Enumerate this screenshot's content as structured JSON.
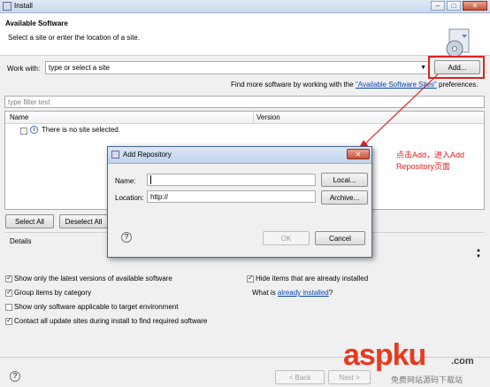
{
  "window": {
    "title": "Install",
    "controls": {
      "minimize": "–",
      "maximize": "□",
      "close": "✕"
    }
  },
  "header": {
    "title": "Available Software",
    "subtitle": "Select a site or enter the location of a site."
  },
  "work_with": {
    "label": "Work with:",
    "value": "type or select a site",
    "add_button": "Add..."
  },
  "find_more": {
    "prefix": "Find more software by working with the ",
    "link": "\"Available Software Sites\"",
    "suffix": " preferences."
  },
  "filter": {
    "placeholder": "type filter text"
  },
  "table": {
    "columns": [
      "Name",
      "Version"
    ],
    "empty_row": "There is no site selected."
  },
  "selection_buttons": {
    "select_all": "Select All",
    "deselect_all": "Deselect All"
  },
  "details": {
    "label": "Details"
  },
  "options": {
    "latest_versions": "Show only the latest versions of available software",
    "group_by_category": "Group items by category",
    "applicable_only": "Show only software applicable to target environment",
    "contact_sites": "Contact all update sites during install to find required software",
    "hide_installed": "Hide items that are already installed",
    "what_is_prefix": "What is ",
    "already_installed_link": "already installed",
    "what_is_suffix": "?"
  },
  "footer": {
    "back": "< Back",
    "next": "Next >",
    "help": "?"
  },
  "dialog": {
    "title": "Add Repository",
    "close": "✕",
    "name_label": "Name:",
    "name_value": "",
    "local_button": "Local...",
    "location_label": "Location:",
    "location_value": "http://",
    "archive_button": "Archive...",
    "ok": "OK",
    "cancel": "Cancel",
    "help": "?"
  },
  "annotation": {
    "line1": "点击Add，进入Add",
    "line2": "Repository页面"
  },
  "watermark": {
    "brand": "aspku",
    "domain": ".com",
    "caption": "免费网站源码下载站"
  },
  "colors": {
    "annotation_red": "#e02020",
    "link_blue": "#0645ad",
    "watermark_red": "#e83a1f"
  }
}
